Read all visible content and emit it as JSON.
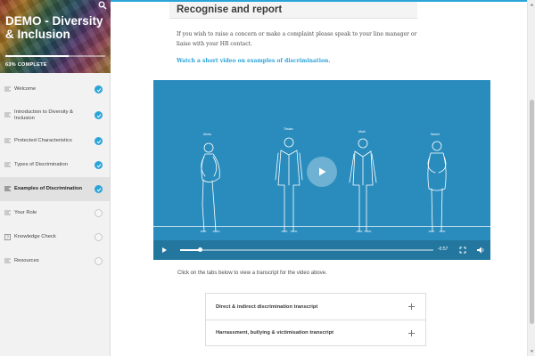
{
  "course": {
    "title": "DEMO - Diversity & Inclusion",
    "progress_percent": 63,
    "progress_label": "63% COMPLETE"
  },
  "sidebar": {
    "items": [
      {
        "label": "Welcome",
        "icon": "lines-icon",
        "status": "complete"
      },
      {
        "label": "Introduction to Diversity & Inclusion",
        "icon": "lines-icon",
        "status": "complete"
      },
      {
        "label": "Protected Characteristics",
        "icon": "lines-icon",
        "status": "complete"
      },
      {
        "label": "Types of Discrimination",
        "icon": "lines-icon",
        "status": "complete"
      },
      {
        "label": "Examples of Discrimination",
        "icon": "lines-icon",
        "status": "complete",
        "active": true
      },
      {
        "label": "Your Role",
        "icon": "lines-icon",
        "status": "incomplete"
      },
      {
        "label": "Knowledge Check",
        "icon": "quiz-icon",
        "status": "incomplete"
      },
      {
        "label": "Resources",
        "icon": "lines-icon",
        "status": "incomplete"
      }
    ]
  },
  "main": {
    "heading": "Recognise and report",
    "paragraph": "If you wish to raise a concern or make a complaint please speak to your line manager or liaise with your HR contact.",
    "video_link": "Watch a short video on examples of discrimination.",
    "video": {
      "figure_labels": [
        "Aisha",
        "Tristan",
        "Mark",
        "Naomi"
      ],
      "time": "-0:57",
      "played_fraction": 0.08,
      "accent_color": "#2a8cbd"
    },
    "instruction": "Click on the tabs below to view a transcript for the video above.",
    "accordion": [
      {
        "label": "Direct & indirect discrimination transcript"
      },
      {
        "label": "Harrassment, bullying & victimisation transcript"
      }
    ]
  },
  "colors": {
    "accent": "#2ba4d9",
    "sidebar_bg": "#f2f2f2"
  }
}
